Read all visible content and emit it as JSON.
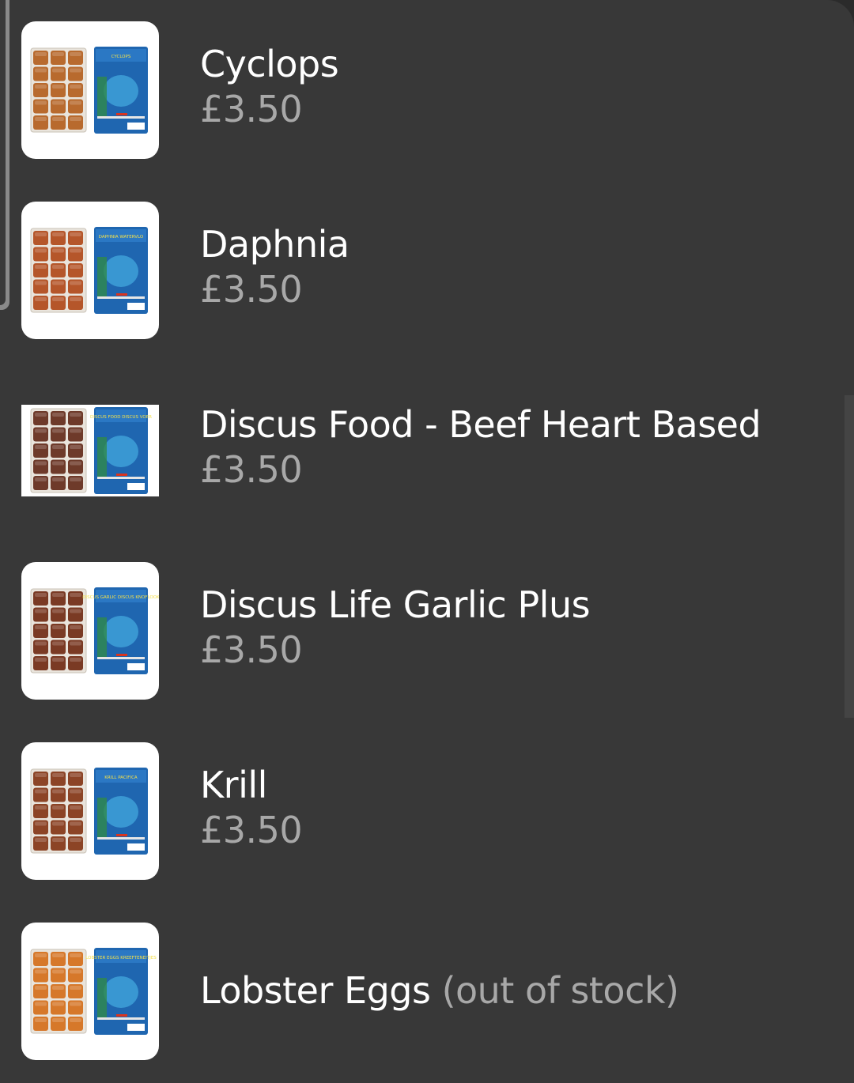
{
  "colors": {
    "background": "#383838",
    "name_text": "#ffffff",
    "price_text": "#a8a8a8",
    "thumbnail_bg": "#ffffff"
  },
  "products": [
    {
      "name": "Cyclops",
      "price": "£3.50",
      "image_icon": "frozen-food-pack-icon",
      "package_label": "CYCLOPS",
      "cube_color": "#b86a2e"
    },
    {
      "name": "Daphnia",
      "price": "£3.50",
      "image_icon": "frozen-food-pack-icon",
      "package_label": "DAPHNIA WATERVLO",
      "cube_color": "#b5562a"
    },
    {
      "name": "Discus Food - Beef Heart Based",
      "price": "£3.50",
      "image_icon": "frozen-food-pack-icon",
      "package_label": "DISCUS FOOD DISCUS VOER",
      "cube_color": "#6e3a2a"
    },
    {
      "name": "Discus Life Garlic Plus",
      "price": "£3.50",
      "image_icon": "frozen-food-pack-icon",
      "package_label": "DISCUS GARLIC DISCUS KNOFLOOK",
      "cube_color": "#7a3a24"
    },
    {
      "name": "Krill",
      "price": "£3.50",
      "image_icon": "frozen-food-pack-icon",
      "package_label": "KRILL PACIFICA",
      "cube_color": "#8c4426"
    },
    {
      "name": "Lobster Eggs",
      "status": "(out of stock)",
      "image_icon": "frozen-food-pack-icon",
      "package_label": "LOBSTER EGGS KREEFTENEITJES",
      "cube_color": "#d6782a"
    }
  ]
}
